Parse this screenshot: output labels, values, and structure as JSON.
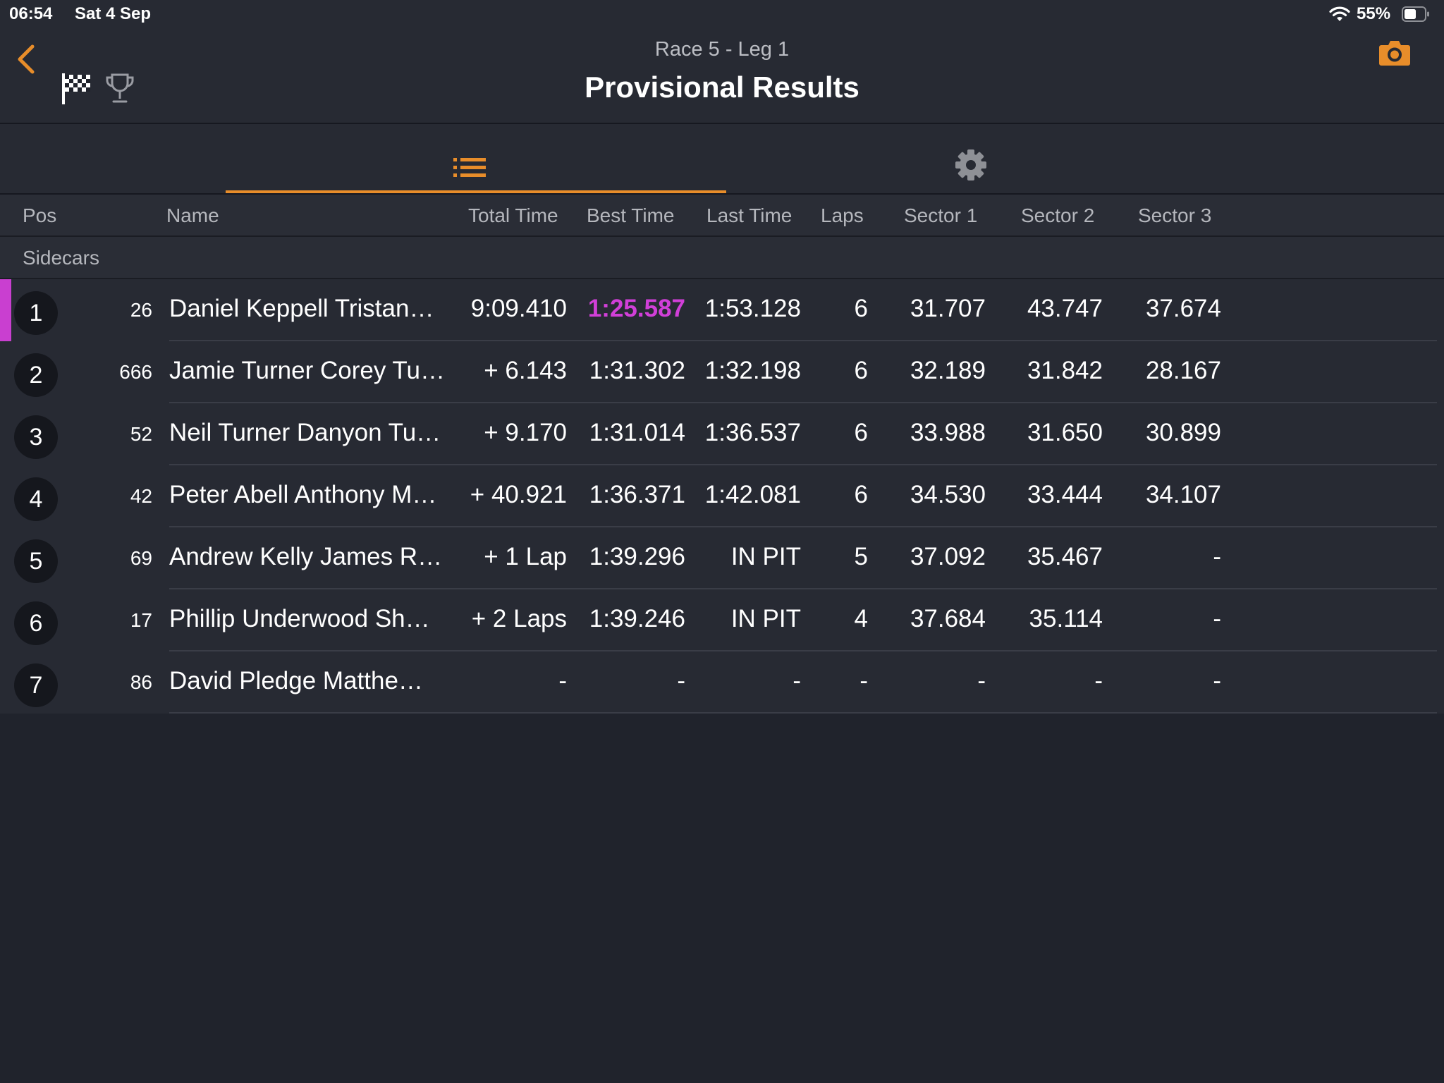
{
  "status_bar": {
    "time": "06:54",
    "date": "Sat 4 Sep",
    "battery": "55%"
  },
  "header": {
    "subtitle": "Race 5 - Leg 1",
    "title": "Provisional Results"
  },
  "columns": {
    "pos": "Pos",
    "name": "Name",
    "total_time": "Total Time",
    "best_time": "Best Time",
    "last_time": "Last Time",
    "laps": "Laps",
    "sector1": "Sector 1",
    "sector2": "Sector 2",
    "sector3": "Sector 3"
  },
  "group": "Sidecars",
  "colors": {
    "accent": "#e88d2a",
    "fastest": "#d13fd8"
  },
  "rows": [
    {
      "pos": "1",
      "num": "26",
      "name": "Daniel Keppell Tristan…",
      "total": "9:09.410",
      "best": "1:25.587",
      "last": "1:53.128",
      "laps": "6",
      "s1": "31.707",
      "s2": "43.747",
      "s3": "37.674"
    },
    {
      "pos": "2",
      "num": "666",
      "name": "Jamie Turner Corey Tu…",
      "total": "+ 6.143",
      "best": "1:31.302",
      "last": "1:32.198",
      "laps": "6",
      "s1": "32.189",
      "s2": "31.842",
      "s3": "28.167"
    },
    {
      "pos": "3",
      "num": "52",
      "name": "Neil Turner Danyon Tu…",
      "total": "+ 9.170",
      "best": "1:31.014",
      "last": "1:36.537",
      "laps": "6",
      "s1": "33.988",
      "s2": "31.650",
      "s3": "30.899"
    },
    {
      "pos": "4",
      "num": "42",
      "name": "Peter Abell Anthony M…",
      "total": "+ 40.921",
      "best": "1:36.371",
      "last": "1:42.081",
      "laps": "6",
      "s1": "34.530",
      "s2": "33.444",
      "s3": "34.107"
    },
    {
      "pos": "5",
      "num": "69",
      "name": "Andrew Kelly James R…",
      "total": "+ 1 Lap",
      "best": "1:39.296",
      "last": "IN PIT",
      "laps": "5",
      "s1": "37.092",
      "s2": "35.467",
      "s3": "-"
    },
    {
      "pos": "6",
      "num": "17",
      "name": "Phillip Underwood Sh…",
      "total": "+ 2 Laps",
      "best": "1:39.246",
      "last": "IN PIT",
      "laps": "4",
      "s1": "37.684",
      "s2": "35.114",
      "s3": "-"
    },
    {
      "pos": "7",
      "num": "86",
      "name": "David Pledge Matthe…",
      "total": "-",
      "best": "-",
      "last": "-",
      "laps": "-",
      "s1": "-",
      "s2": "-",
      "s3": "-"
    }
  ]
}
